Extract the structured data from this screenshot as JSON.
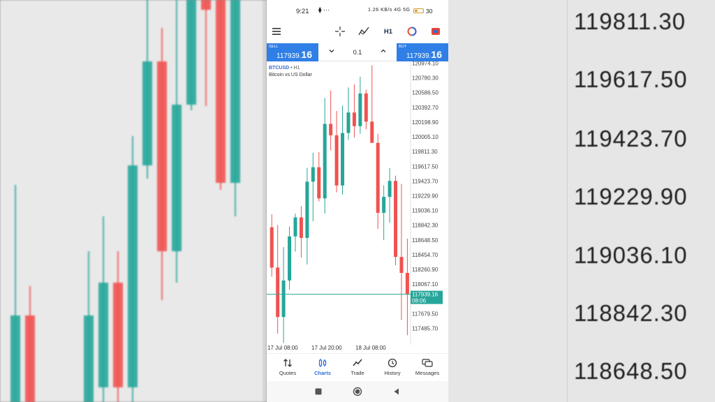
{
  "status_bar": {
    "time": "9:21",
    "icons": "⧫ ···",
    "signal": "1.26 KB/s 4G 5G",
    "battery": "30"
  },
  "toolbar": {
    "timeframe": "H1",
    "icons": [
      "menu-icon",
      "crosshair-icon",
      "indicators-icon",
      "timeframe",
      "color-circle-icon",
      "objects-icon"
    ]
  },
  "trade": {
    "sell_label": "SELL",
    "buy_label": "BUY",
    "sell_main": "117939.",
    "sell_big": "16",
    "buy_main": "117939.",
    "buy_big": "16",
    "lot": "0.1"
  },
  "chart": {
    "symbol": "BTCUSD",
    "timeframe_tag": "• H1",
    "description": "Bitcoin vs US Dollar"
  },
  "chart_data": {
    "type": "candlestick",
    "y_labels": [
      "120974.10",
      "120780.30",
      "120586.50",
      "120392.70",
      "120198.90",
      "120005.10",
      "119811.30",
      "119617.50",
      "119423.70",
      "119229.90",
      "119036.10",
      "118842.30",
      "118648.50",
      "118454.70",
      "118260.90",
      "118067.10",
      "117679.50",
      "117485.70"
    ],
    "x_labels": [
      "17 Jul 08:00",
      "17 Jul 20:00",
      "18 Jul 08:00"
    ],
    "current_price": "117939.16",
    "timer": "08:06",
    "ylim": [
      117485.7,
      120974.1
    ],
    "candles": [
      {
        "o": 118820,
        "h": 118990,
        "l": 118170,
        "c": 118290
      },
      {
        "o": 118290,
        "h": 118850,
        "l": 117420,
        "c": 117640
      },
      {
        "o": 117640,
        "h": 118560,
        "l": 117300,
        "c": 118120
      },
      {
        "o": 118120,
        "h": 118830,
        "l": 118000,
        "c": 118700
      },
      {
        "o": 118700,
        "h": 119000,
        "l": 118500,
        "c": 118950
      },
      {
        "o": 118950,
        "h": 119100,
        "l": 118420,
        "c": 118680
      },
      {
        "o": 118680,
        "h": 119600,
        "l": 118330,
        "c": 119420
      },
      {
        "o": 119420,
        "h": 119800,
        "l": 118900,
        "c": 119610
      },
      {
        "o": 119610,
        "h": 119810,
        "l": 119160,
        "c": 119200
      },
      {
        "o": 119200,
        "h": 120520,
        "l": 119000,
        "c": 120180
      },
      {
        "o": 120180,
        "h": 120620,
        "l": 119830,
        "c": 120030
      },
      {
        "o": 120030,
        "h": 120350,
        "l": 119280,
        "c": 119370
      },
      {
        "o": 119370,
        "h": 120420,
        "l": 119250,
        "c": 120060
      },
      {
        "o": 120060,
        "h": 120660,
        "l": 119970,
        "c": 120330
      },
      {
        "o": 120330,
        "h": 120700,
        "l": 120000,
        "c": 120150
      },
      {
        "o": 120150,
        "h": 120800,
        "l": 120050,
        "c": 120580
      },
      {
        "o": 120580,
        "h": 120630,
        "l": 120110,
        "c": 120210
      },
      {
        "o": 120210,
        "h": 120950,
        "l": 120010,
        "c": 119930
      },
      {
        "o": 119930,
        "h": 120050,
        "l": 118800,
        "c": 119010
      },
      {
        "o": 119010,
        "h": 119370,
        "l": 118650,
        "c": 119220
      },
      {
        "o": 119220,
        "h": 119600,
        "l": 118880,
        "c": 119430
      },
      {
        "o": 119430,
        "h": 119500,
        "l": 118320,
        "c": 118430
      },
      {
        "o": 118430,
        "h": 119390,
        "l": 117600,
        "c": 118220
      },
      {
        "o": 118220,
        "h": 118670,
        "l": 117400,
        "c": 117939.16
      }
    ]
  },
  "bottom_nav": [
    {
      "label": "Quotes",
      "icon": "quotes-icon"
    },
    {
      "label": "Charts",
      "icon": "charts-icon"
    },
    {
      "label": "Trade",
      "icon": "trade-icon"
    },
    {
      "label": "History",
      "icon": "history-icon"
    },
    {
      "label": "Messages",
      "icon": "messages-icon"
    }
  ],
  "background_prices": [
    "119811.30",
    "119617.50",
    "119423.70",
    "119229.90",
    "119036.10",
    "118842.30",
    "118648.50"
  ],
  "colors": {
    "bull": "#26a69a",
    "bear": "#ef5350",
    "accent": "#2f7fe6",
    "price_line": "#26a69a"
  }
}
